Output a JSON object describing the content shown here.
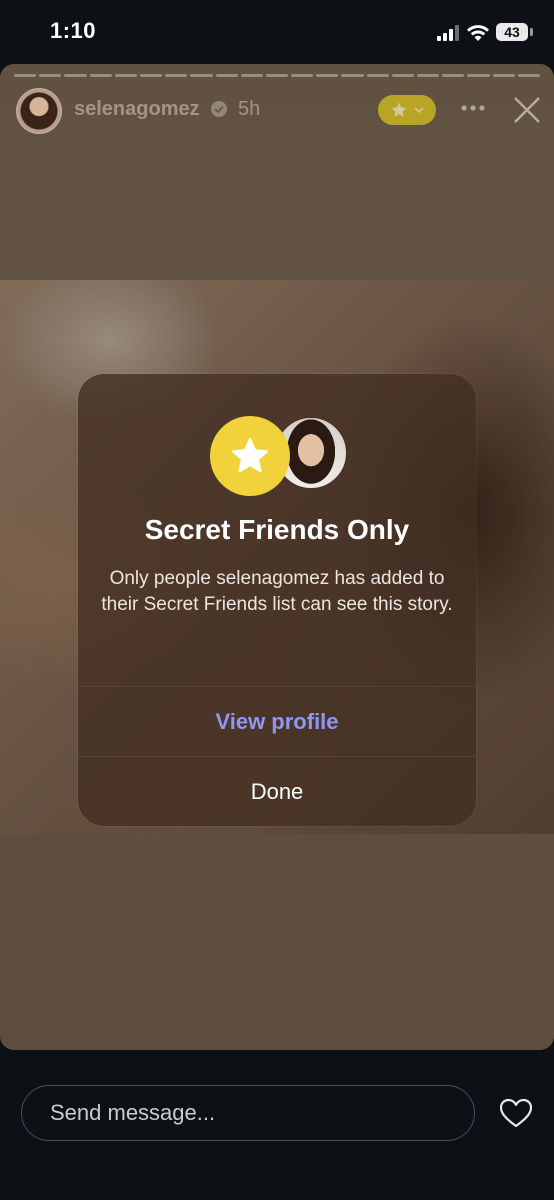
{
  "status_bar": {
    "time": "1:10",
    "battery": "43",
    "icons": [
      "signal-icon",
      "wifi-icon",
      "battery-icon"
    ]
  },
  "story_header": {
    "username": "selenagomez",
    "time_ago": "5h",
    "icons": [
      "verified-icon",
      "star-icon",
      "chevron-down-icon",
      "more-icon",
      "close-icon"
    ],
    "progress_segments": 21
  },
  "modal": {
    "title": "Secret Friends Only",
    "body": "Only people selenagomez has added to their Secret Friends list can see this story.",
    "primary_action": "View profile",
    "secondary_action": "Done",
    "icons": [
      "star-icon"
    ]
  },
  "footer": {
    "message_placeholder": "Send message...",
    "icons": [
      "heart-icon"
    ]
  },
  "colors": {
    "star_badge": "#f2d23a",
    "link": "#8e97f5",
    "background": "#0d1014"
  }
}
